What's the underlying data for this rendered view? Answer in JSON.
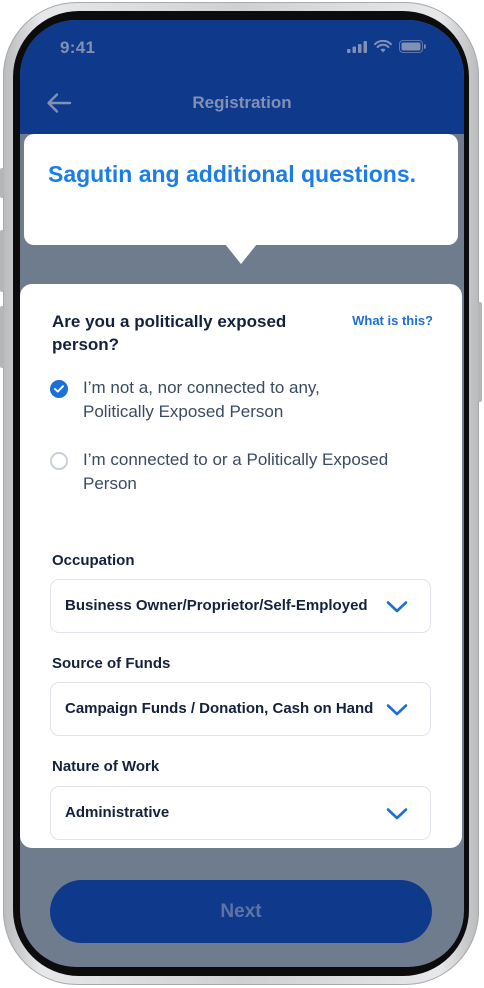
{
  "status_bar": {
    "time": "9:41"
  },
  "header": {
    "title": "Registration"
  },
  "tooltip": {
    "text": "Sagutin ang additional questions."
  },
  "question": {
    "title": "Are you a politically exposed person?",
    "help_link": "What is this?",
    "options": [
      {
        "label": "I’m not a, nor connected to any, Politically Exposed Person",
        "selected": true
      },
      {
        "label": "I’m connected to or a Politically Exposed Person",
        "selected": false
      }
    ]
  },
  "fields": [
    {
      "label": "Occupation",
      "value": "Business Owner/Proprietor/Self-Employed"
    },
    {
      "label": "Source of Funds",
      "value": "Campaign Funds / Donation, Cash on Hand"
    },
    {
      "label": "Nature of Work",
      "value": "Administrative"
    }
  ],
  "next_button": {
    "label": "Next"
  },
  "colors": {
    "header_blue": "#0f3a8c",
    "accent_blue": "#1b6fd6",
    "overlay": "#6f7c8d"
  }
}
